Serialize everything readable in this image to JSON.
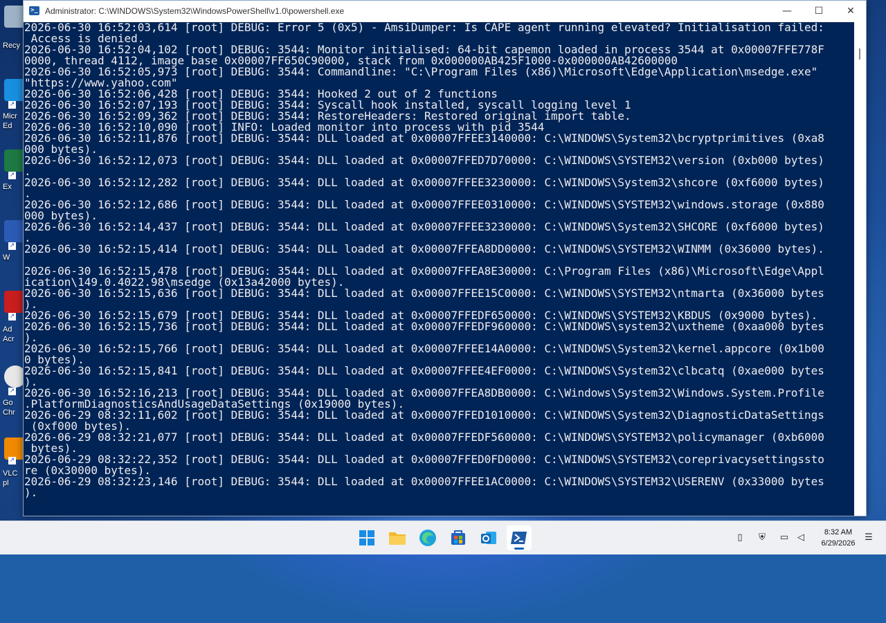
{
  "window": {
    "title": "Administrator: C:\\WINDOWS\\System32\\WindowsPowerShell\\v1.0\\powershell.exe",
    "controls": {
      "minimize": "—",
      "maximize": "☐",
      "close": "✕"
    }
  },
  "console": {
    "lines": [
      "2026-06-30 16:52:03,614 [root] DEBUG: Error 5 (0x5) - AmsiDumper: Is CAPE agent running elevated? Initialisation failed:",
      " Access is denied.",
      "2026-06-30 16:52:04,102 [root] DEBUG: 3544: Monitor initialised: 64-bit capemon loaded in process 3544 at 0x00007FFE778F",
      "0000, thread 4112, image base 0x00007FF650C90000, stack from 0x000000AB425F1000-0x000000AB42600000",
      "2026-06-30 16:52:05,973 [root] DEBUG: 3544: Commandline: \"C:\\Program Files (x86)\\Microsoft\\Edge\\Application\\msedge.exe\"",
      "\"https://www.yahoo.com\"",
      "2026-06-30 16:52:06,428 [root] DEBUG: 3544: Hooked 2 out of 2 functions",
      "2026-06-30 16:52:07,193 [root] DEBUG: 3544: Syscall hook installed, syscall logging level 1",
      "2026-06-30 16:52:09,362 [root] DEBUG: 3544: RestoreHeaders: Restored original import table.",
      "2026-06-30 16:52:10,090 [root] INFO: Loaded monitor into process with pid 3544",
      "2026-06-30 16:52:11,876 [root] DEBUG: 3544: DLL loaded at 0x00007FFEE3140000: C:\\WINDOWS\\System32\\bcryptprimitives (0xa8",
      "000 bytes).",
      "2026-06-30 16:52:12,073 [root] DEBUG: 3544: DLL loaded at 0x00007FFED7D70000: C:\\WINDOWS\\SYSTEM32\\version (0xb000 bytes)",
      ".",
      "2026-06-30 16:52:12,282 [root] DEBUG: 3544: DLL loaded at 0x00007FFEE3230000: C:\\WINDOWS\\System32\\shcore (0xf6000 bytes)",
      ".",
      "2026-06-30 16:52:12,686 [root] DEBUG: 3544: DLL loaded at 0x00007FFEE0310000: C:\\WINDOWS\\SYSTEM32\\windows.storage (0x880",
      "000 bytes).",
      "2026-06-30 16:52:14,437 [root] DEBUG: 3544: DLL loaded at 0x00007FFEE3230000: C:\\WINDOWS\\System32\\SHCORE (0xf6000 bytes)",
      ".",
      "2026-06-30 16:52:15,414 [root] DEBUG: 3544: DLL loaded at 0x00007FFEA8DD0000: C:\\WINDOWS\\SYSTEM32\\WINMM (0x36000 bytes).",
      "",
      "2026-06-30 16:52:15,478 [root] DEBUG: 3544: DLL loaded at 0x00007FFEA8E30000: C:\\Program Files (x86)\\Microsoft\\Edge\\Appl",
      "ication\\149.0.4022.98\\msedge (0x13a42000 bytes).",
      "2026-06-30 16:52:15,636 [root] DEBUG: 3544: DLL loaded at 0x00007FFEE15C0000: C:\\WINDOWS\\SYSTEM32\\ntmarta (0x36000 bytes",
      ").",
      "2026-06-30 16:52:15,679 [root] DEBUG: 3544: DLL loaded at 0x00007FFEDF650000: C:\\WINDOWS\\SYSTEM32\\KBDUS (0x9000 bytes).",
      "2026-06-30 16:52:15,736 [root] DEBUG: 3544: DLL loaded at 0x00007FFEDF960000: C:\\WINDOWS\\system32\\uxtheme (0xaa000 bytes",
      ").",
      "2026-06-30 16:52:15,766 [root] DEBUG: 3544: DLL loaded at 0x00007FFEE14A0000: C:\\WINDOWS\\System32\\kernel.appcore (0x1b00",
      "0 bytes).",
      "2026-06-30 16:52:15,841 [root] DEBUG: 3544: DLL loaded at 0x00007FFEE4EF0000: C:\\WINDOWS\\System32\\clbcatq (0xae000 bytes",
      ").",
      "2026-06-30 16:52:16,213 [root] DEBUG: 3544: DLL loaded at 0x00007FFEA8DB0000: C:\\Windows\\System32\\Windows.System.Profile",
      ".PlatformDiagnosticsAndUsageDataSettings (0x19000 bytes).",
      "2026-06-29 08:32:11,602 [root] DEBUG: 3544: DLL loaded at 0x00007FFED1010000: C:\\WINDOWS\\System32\\DiagnosticDataSettings",
      " (0xf000 bytes).",
      "2026-06-29 08:32:21,077 [root] DEBUG: 3544: DLL loaded at 0x00007FFEDF560000: C:\\WINDOWS\\SYSTEM32\\policymanager (0xb6000",
      " bytes).",
      "2026-06-29 08:32:22,352 [root] DEBUG: 3544: DLL loaded at 0x00007FFED0FD0000: C:\\WINDOWS\\SYSTEM32\\coreprivacysettingssto",
      "re (0x30000 bytes).",
      "2026-06-29 08:32:23,146 [root] DEBUG: 3544: DLL loaded at 0x00007FFEE1AC0000: C:\\WINDOWS\\SYSTEM32\\USERENV (0x33000 bytes",
      ")."
    ]
  },
  "desktop": {
    "icons": [
      {
        "label": "Recy",
        "color": "#9fb3c8"
      },
      {
        "label": "Micr",
        "color": "#1a8fe0"
      },
      {
        "label": "Ex",
        "color": "#1d7a44"
      },
      {
        "label": "W",
        "color": "#2b5bb5"
      },
      {
        "label": "Ad",
        "color": "#c81e1e"
      },
      {
        "label": "Go",
        "color": "#e8e8e8"
      },
      {
        "label": "VLC",
        "color": "#f08a00"
      }
    ],
    "extra_labels": [
      "Ed",
      "Acr",
      "Chr",
      "pl"
    ]
  },
  "taskbar": {
    "apps": [
      {
        "name": "start",
        "color": "#1a8ce6",
        "active": false
      },
      {
        "name": "file-explorer",
        "color": "#f4b82c",
        "active": false
      },
      {
        "name": "edge",
        "color": "#1ea3d8",
        "active": false
      },
      {
        "name": "store",
        "color": "#1e63c4",
        "active": false
      },
      {
        "name": "outlook",
        "color": "#0f6cbd",
        "active": false
      },
      {
        "name": "powershell",
        "color": "#1e5aa6",
        "active": true
      }
    ],
    "tray": [
      "usb-icon",
      "security-icon",
      "network-icon",
      "volume-icon",
      "notification-icon"
    ],
    "time": "8:32 AM",
    "date": "6/29/2026"
  }
}
